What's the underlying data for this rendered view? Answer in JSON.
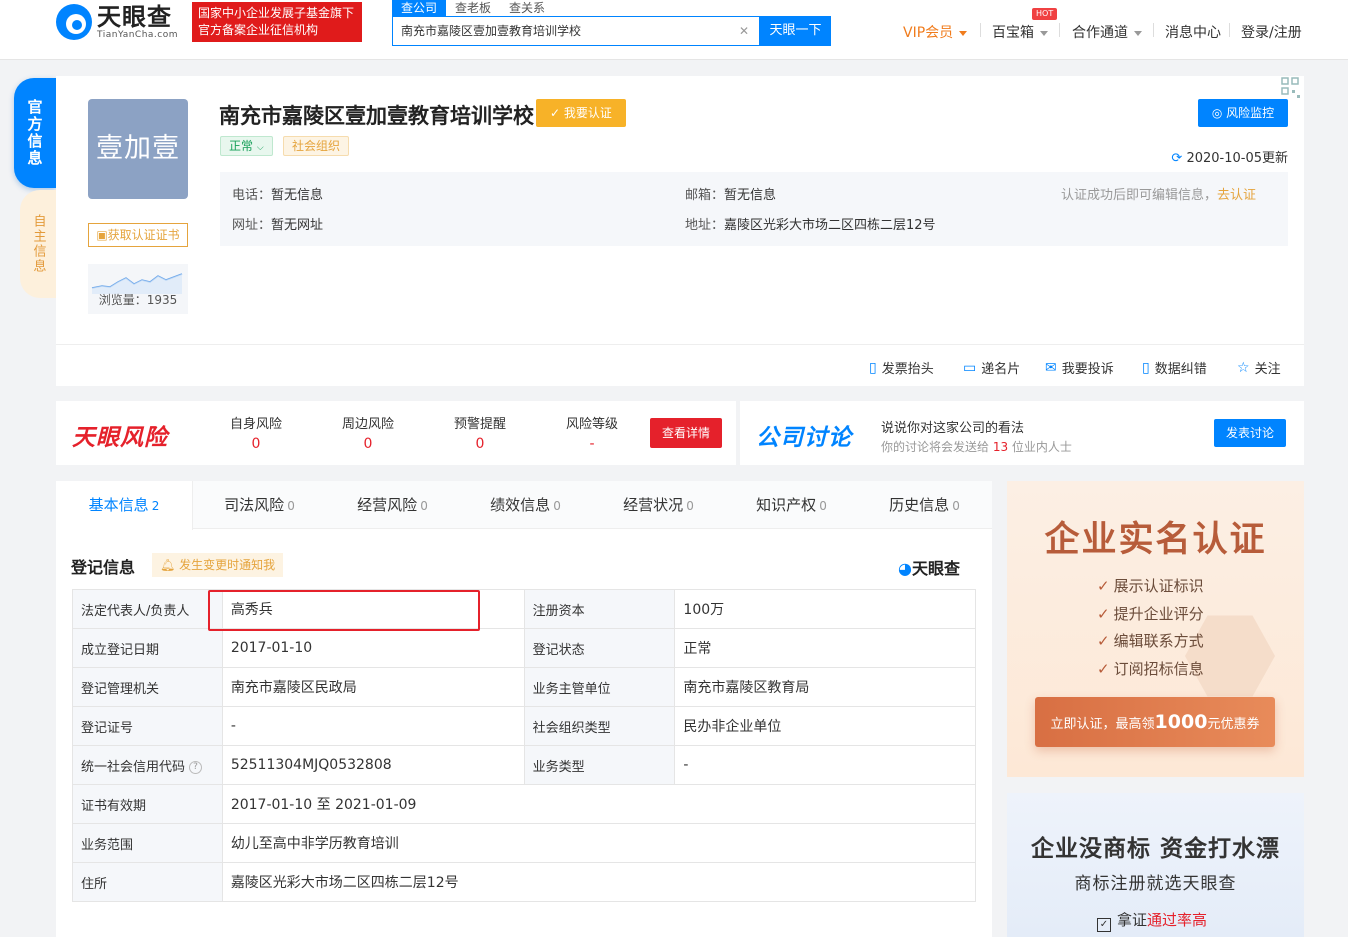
{
  "header": {
    "logo_cn": "天眼查",
    "logo_en": "TianYanCha.com",
    "badge_line1": "国家中小企业发展子基金旗下",
    "badge_line2": "官方备案企业征信机构",
    "search_tabs": [
      "查公司",
      "查老板",
      "查关系"
    ],
    "search_value": "南充市嘉陵区壹加壹教育培训学校",
    "search_button": "天眼一下",
    "nav": {
      "vip": "VIP会员",
      "baibao": "百宝箱",
      "hot": "HOT",
      "coop": "合作通道",
      "messages": "消息中心",
      "login": "登录/注册"
    }
  },
  "side_tabs": {
    "official": "官方信息",
    "self": "自主信息"
  },
  "company": {
    "logo_text": "壹加壹",
    "name": "南充市嘉陵区壹加壹教育培训学校",
    "verify": "我要认证",
    "status": "正常",
    "org_type_tag": "社会组织",
    "cert_button": "获取认证证书",
    "views_label": "浏览量：1935",
    "risk_monitor": "风险监控",
    "updated": "2020-10-05更新",
    "phone_label": "电话：",
    "phone": "暂无信息",
    "email_label": "邮箱：",
    "email": "暂无信息",
    "website_label": "网址：",
    "website": "暂无网址",
    "address_label": "地址：",
    "address": "嘉陵区光彩大市场二区四栋二层12号",
    "edit_hint": "认证成功后即可编辑信息，",
    "edit_link": "去认证"
  },
  "actions": [
    "发票抬头",
    "递名片",
    "我要投诉",
    "数据纠错",
    "关注"
  ],
  "risk": {
    "brand": "天眼风险",
    "cols": [
      {
        "label": "自身风险",
        "value": "0"
      },
      {
        "label": "周边风险",
        "value": "0"
      },
      {
        "label": "预警提醒",
        "value": "0"
      },
      {
        "label": "风险等级",
        "value": "-"
      }
    ],
    "detail": "查看详情"
  },
  "discussion": {
    "brand": "公司讨论",
    "title": "说说你对这家公司的看法",
    "sub_prefix": "你的讨论将会发送给 ",
    "sub_count": "13",
    "sub_suffix": " 位业内人士",
    "button": "发表讨论"
  },
  "tabs": [
    {
      "label": "基本信息",
      "count": "2"
    },
    {
      "label": "司法风险",
      "count": "0"
    },
    {
      "label": "经营风险",
      "count": "0"
    },
    {
      "label": "绩效信息",
      "count": "0"
    },
    {
      "label": "经营状况",
      "count": "0"
    },
    {
      "label": "知识产权",
      "count": "0"
    },
    {
      "label": "历史信息",
      "count": "0"
    }
  ],
  "registration": {
    "title": "登记信息",
    "notify": "发生变更时通知我",
    "watermark": "天眼查",
    "rows": {
      "legal_rep_k": "法定代表人/负责人",
      "legal_rep_v": "高秀兵",
      "capital_k": "注册资本",
      "capital_v": "100万",
      "date_k": "成立登记日期",
      "date_v": "2017-01-10",
      "state_k": "登记状态",
      "state_v": "正常",
      "authority_k": "登记管理机关",
      "authority_v": "南充市嘉陵区民政局",
      "supervisor_k": "业务主管单位",
      "supervisor_v": "南充市嘉陵区教育局",
      "certno_k": "登记证号",
      "certno_v": "-",
      "orgtype_k": "社会组织类型",
      "orgtype_v": "民办非企业单位",
      "uscc_k": "统一社会信用代码",
      "uscc_v": "52511304MJQ0532808",
      "biztype_k": "业务类型",
      "biztype_v": "-",
      "validity_k": "证书有效期",
      "validity_v": "2017-01-10 至 2021-01-09",
      "scope_k": "业务范围",
      "scope_v": "幼儿至高中非学历教育培训",
      "residence_k": "住所",
      "residence_v": "嘉陵区光彩大市场二区四栋二层12号"
    }
  },
  "promo1": {
    "title": "企业实名认证",
    "items": [
      "展示认证标识",
      "提升企业评分",
      "编辑联系方式",
      "订阅招标信息"
    ],
    "btn_prefix": "立即认证，最高领",
    "btn_amount": "1000",
    "btn_suffix": "元优惠券"
  },
  "promo2": {
    "title": "企业没商标 资金打水漂",
    "sub": "商标注册就选天眼查",
    "chk_prefix": "拿证",
    "chk_em": "通过率高"
  }
}
